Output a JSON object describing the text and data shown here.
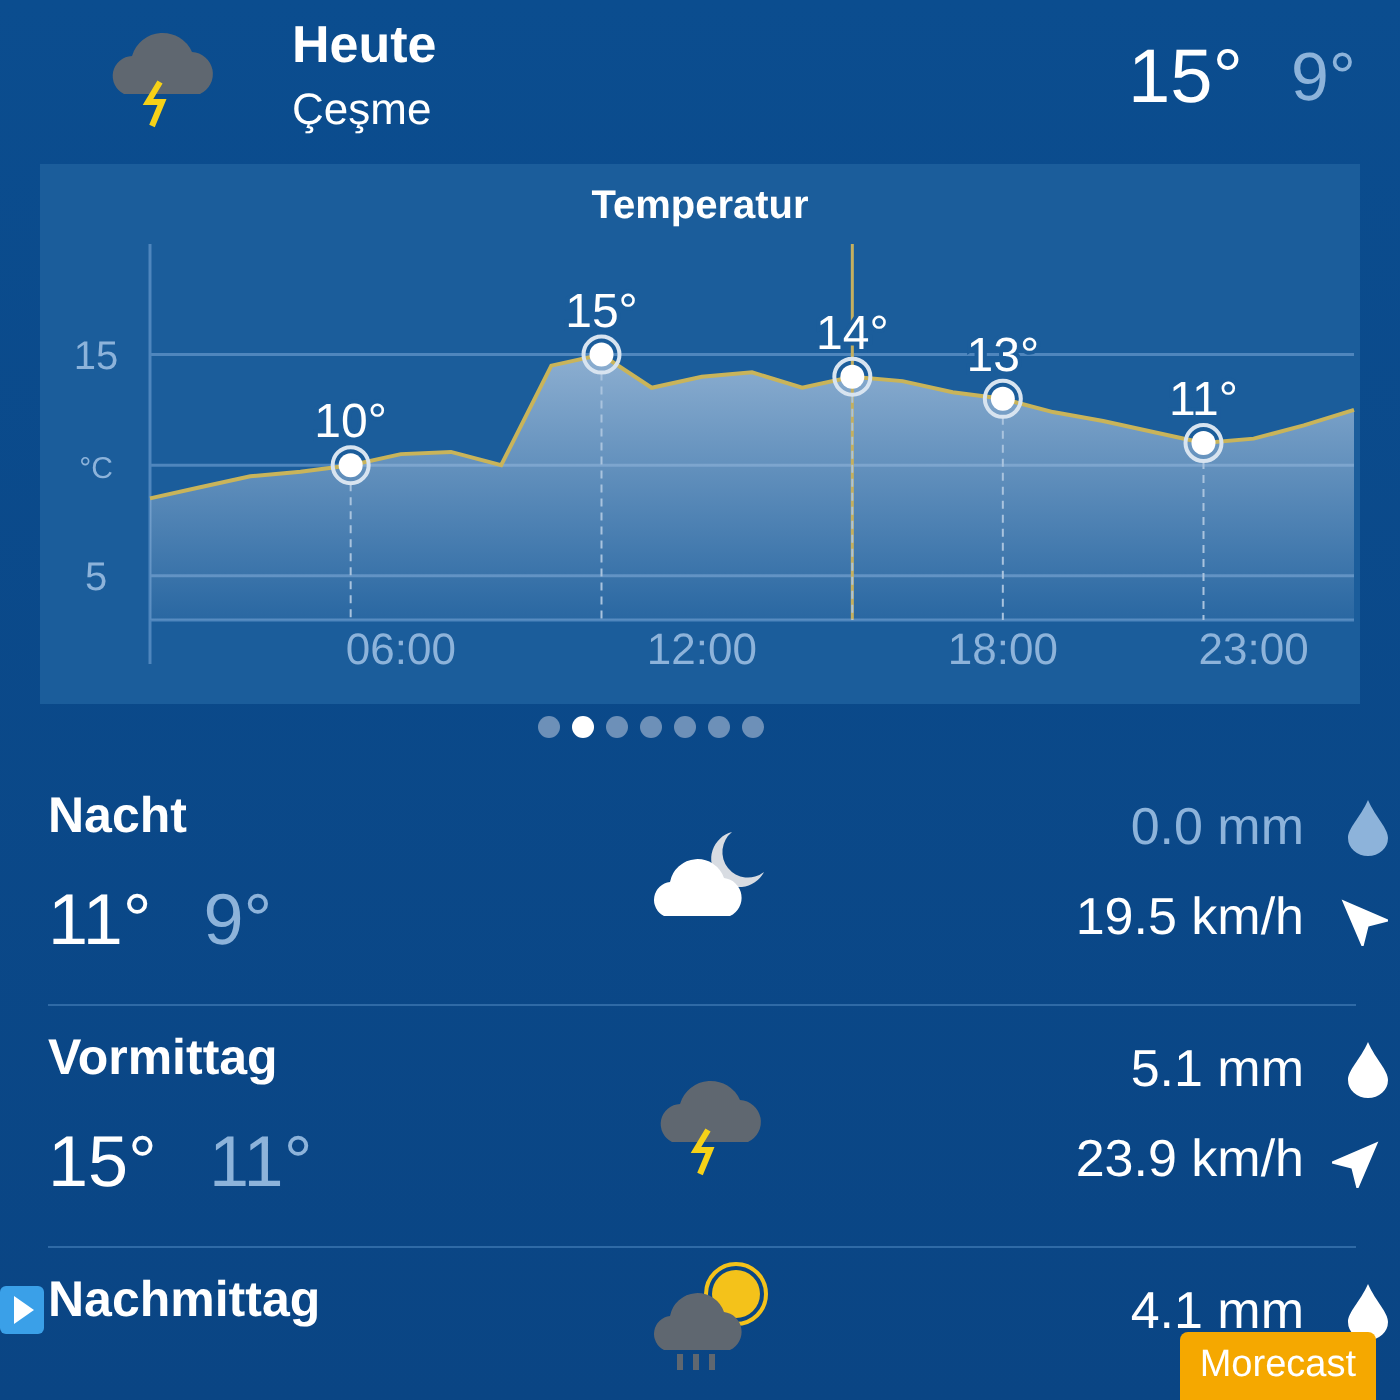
{
  "header": {
    "title": "Heute",
    "location": "Çeşme",
    "high": "15°",
    "low": "9°"
  },
  "chart": {
    "chart_data": {
      "type": "area",
      "title": "Temperatur",
      "ylabel": "°C",
      "x": [
        1,
        2,
        3,
        4,
        5,
        6,
        7,
        8,
        9,
        10,
        11,
        12,
        13,
        14,
        15,
        16,
        17,
        18,
        19,
        20,
        21,
        22,
        23,
        24,
        25
      ],
      "series": [
        {
          "color": "#c9b45a",
          "values": [
            8.5,
            9,
            9.5,
            9.7,
            10,
            10.5,
            10.6,
            10,
            14.5,
            15,
            13.5,
            14,
            14.2,
            13.5,
            14,
            13.8,
            13.3,
            13,
            12.4,
            12,
            11.5,
            11,
            11.2,
            11.8,
            12.5
          ]
        }
      ],
      "xlim": [
        1,
        25
      ],
      "ylim": [
        3,
        20
      ],
      "yticks": [
        5,
        15
      ],
      "ref_lines": [
        {
          "axis": "x",
          "value": 15
        }
      ],
      "xticks": [
        {
          "value": 6,
          "label": "06:00"
        },
        {
          "value": 12,
          "label": "12:00"
        },
        {
          "value": 18,
          "label": "18:00"
        },
        {
          "value": 23,
          "label": "23:00"
        }
      ],
      "annotations": [
        {
          "x": 5,
          "y": 10,
          "text": "10°"
        },
        {
          "x": 10,
          "y": 15,
          "text": "15°"
        },
        {
          "x": 15,
          "y": 14,
          "text": "14°"
        },
        {
          "x": 18,
          "y": 13,
          "text": "13°"
        },
        {
          "x": 22,
          "y": 11,
          "text": "11°"
        }
      ]
    }
  },
  "pager": [
    {
      "selected": false
    },
    {
      "selected": true
    },
    {
      "selected": false
    },
    {
      "selected": false
    },
    {
      "selected": false
    },
    {
      "selected": false
    },
    {
      "selected": false
    }
  ],
  "periods": [
    {
      "name": "Nacht",
      "high": "11°",
      "low": "9°",
      "kind": "cloudy-night",
      "precip": "0.0 mm",
      "dry": true,
      "wind": "19.5 km/h"
    },
    {
      "name": "Vormittag",
      "high": "15°",
      "low": "11°",
      "kind": "thunderstorm",
      "precip": "5.1 mm",
      "dry": false,
      "wind": "23.9 km/h"
    },
    {
      "name": "Nachmittag",
      "kind": "rain-sun",
      "precip": "4.1 mm",
      "dry": false,
      "marked": true
    }
  ],
  "badge": "Morecast"
}
